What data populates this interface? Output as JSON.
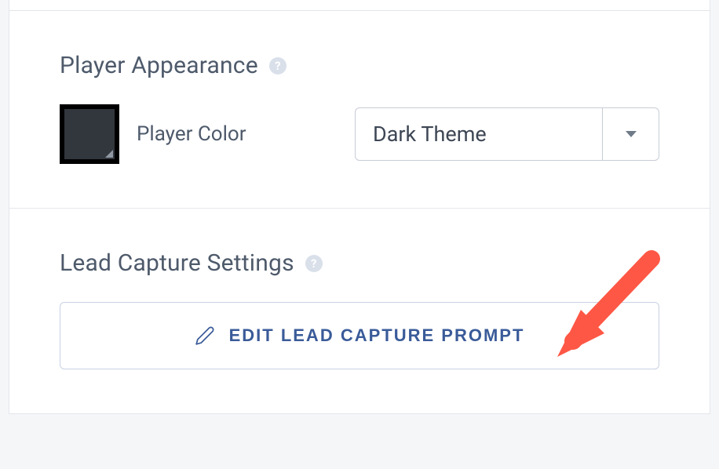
{
  "playerAppearance": {
    "title": "Player Appearance",
    "colorLabel": "Player Color",
    "theme": "Dark Theme"
  },
  "leadCapture": {
    "title": "Lead Capture Settings",
    "buttonLabel": "EDIT LEAD CAPTURE PROMPT"
  },
  "help": "?"
}
